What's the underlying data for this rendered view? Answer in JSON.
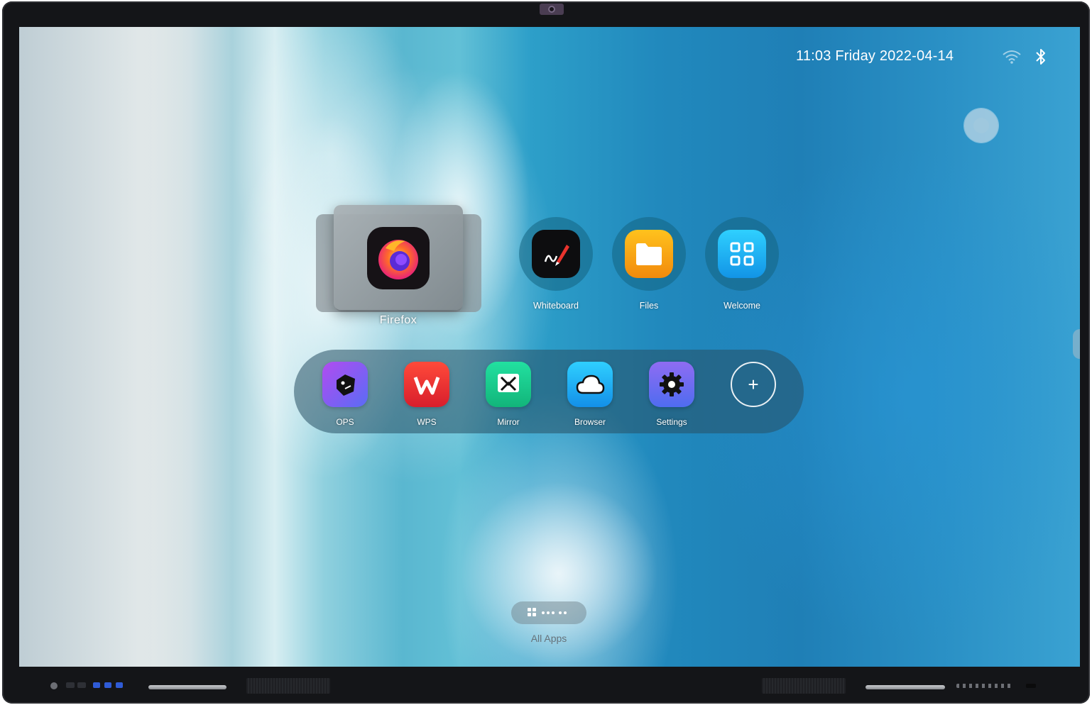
{
  "status_bar": {
    "datetime": "11:03 Friday 2022-04-14",
    "wifi_icon": "wifi-icon",
    "bluetooth_icon": "bluetooth-icon"
  },
  "folder": {
    "label": "Firefox",
    "app_icon": "firefox-icon"
  },
  "top_apps": [
    {
      "label": "Whiteboard",
      "icon": "whiteboard-icon",
      "color": "#0d0d0f"
    },
    {
      "label": "Files",
      "icon": "folder-icon",
      "color": "#f6a414"
    },
    {
      "label": "Welcome",
      "icon": "grid-icon",
      "color": "#1bb2ef"
    }
  ],
  "dock": {
    "apps": [
      {
        "label": "OPS",
        "icon": "ops-icon",
        "color": "#9a4df0"
      },
      {
        "label": "WPS",
        "icon": "wps-icon",
        "color": "#e8332d"
      },
      {
        "label": "Mirror",
        "icon": "mirror-icon",
        "color": "#1fcf8e"
      },
      {
        "label": "Browser",
        "icon": "cloud-icon",
        "color": "#1aa9ef"
      },
      {
        "label": "Settings",
        "icon": "gear-icon",
        "color": "#6d5ce8"
      }
    ],
    "add_label": "+"
  },
  "all_apps": {
    "label": "All Apps"
  }
}
